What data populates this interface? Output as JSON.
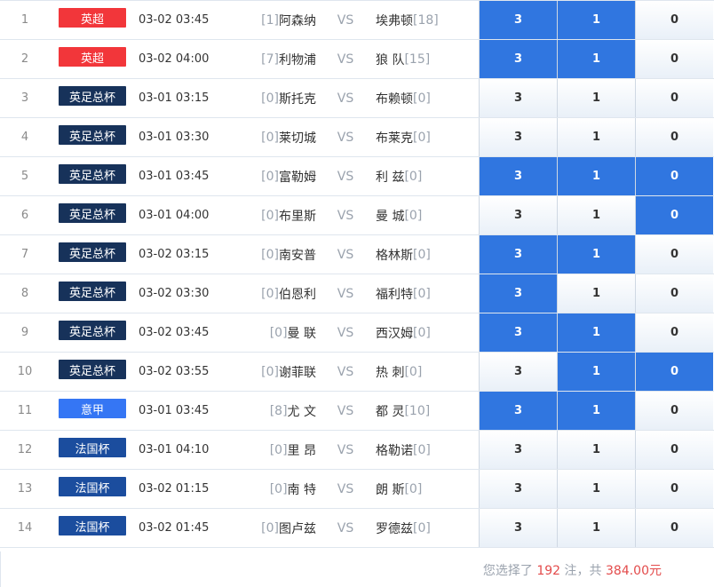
{
  "rows": [
    {
      "idx": "1",
      "league": "英超",
      "league_color": "#f2363a",
      "time": "03-02 03:45",
      "home_rank": "[1]",
      "home": "阿森纳",
      "vs": "VS",
      "away": "埃弗顿",
      "away_rank": "[18]",
      "odds": [
        "3",
        "1",
        "0"
      ],
      "selected": [
        true,
        true,
        false
      ]
    },
    {
      "idx": "2",
      "league": "英超",
      "league_color": "#f2363a",
      "time": "03-02 04:00",
      "home_rank": "[7]",
      "home": "利物浦",
      "vs": "VS",
      "away": "狼 队",
      "away_rank": "[15]",
      "odds": [
        "3",
        "1",
        "0"
      ],
      "selected": [
        true,
        true,
        false
      ]
    },
    {
      "idx": "3",
      "league": "英足总杯",
      "league_color": "#17325a",
      "time": "03-01 03:15",
      "home_rank": "[0]",
      "home": "斯托克",
      "vs": "VS",
      "away": "布赖顿",
      "away_rank": "[0]",
      "odds": [
        "3",
        "1",
        "0"
      ],
      "selected": [
        false,
        false,
        false
      ]
    },
    {
      "idx": "4",
      "league": "英足总杯",
      "league_color": "#17325a",
      "time": "03-01 03:30",
      "home_rank": "[0]",
      "home": "莱切城",
      "vs": "VS",
      "away": "布莱克",
      "away_rank": "[0]",
      "odds": [
        "3",
        "1",
        "0"
      ],
      "selected": [
        false,
        false,
        false
      ]
    },
    {
      "idx": "5",
      "league": "英足总杯",
      "league_color": "#17325a",
      "time": "03-01 03:45",
      "home_rank": "[0]",
      "home": "富勒姆",
      "vs": "VS",
      "away": "利 兹",
      "away_rank": "[0]",
      "odds": [
        "3",
        "1",
        "0"
      ],
      "selected": [
        true,
        true,
        true
      ]
    },
    {
      "idx": "6",
      "league": "英足总杯",
      "league_color": "#17325a",
      "time": "03-01 04:00",
      "home_rank": "[0]",
      "home": "布里斯",
      "vs": "VS",
      "away": "曼 城",
      "away_rank": "[0]",
      "odds": [
        "3",
        "1",
        "0"
      ],
      "selected": [
        false,
        false,
        true
      ]
    },
    {
      "idx": "7",
      "league": "英足总杯",
      "league_color": "#17325a",
      "time": "03-02 03:15",
      "home_rank": "[0]",
      "home": "南安普",
      "vs": "VS",
      "away": "格林斯",
      "away_rank": "[0]",
      "odds": [
        "3",
        "1",
        "0"
      ],
      "selected": [
        true,
        true,
        false
      ]
    },
    {
      "idx": "8",
      "league": "英足总杯",
      "league_color": "#17325a",
      "time": "03-02 03:30",
      "home_rank": "[0]",
      "home": "伯恩利",
      "vs": "VS",
      "away": "福利特",
      "away_rank": "[0]",
      "odds": [
        "3",
        "1",
        "0"
      ],
      "selected": [
        true,
        false,
        false
      ]
    },
    {
      "idx": "9",
      "league": "英足总杯",
      "league_color": "#17325a",
      "time": "03-02 03:45",
      "home_rank": "[0]",
      "home": "曼 联",
      "vs": "VS",
      "away": "西汉姆",
      "away_rank": "[0]",
      "odds": [
        "3",
        "1",
        "0"
      ],
      "selected": [
        true,
        true,
        false
      ]
    },
    {
      "idx": "10",
      "league": "英足总杯",
      "league_color": "#17325a",
      "time": "03-02 03:55",
      "home_rank": "[0]",
      "home": "谢菲联",
      "vs": "VS",
      "away": "热 刺",
      "away_rank": "[0]",
      "odds": [
        "3",
        "1",
        "0"
      ],
      "selected": [
        false,
        true,
        true
      ]
    },
    {
      "idx": "11",
      "league": "意甲",
      "league_color": "#3576f4",
      "time": "03-01 03:45",
      "home_rank": "[8]",
      "home": "尤 文",
      "vs": "VS",
      "away": "都 灵",
      "away_rank": "[10]",
      "odds": [
        "3",
        "1",
        "0"
      ],
      "selected": [
        true,
        true,
        false
      ]
    },
    {
      "idx": "12",
      "league": "法国杯",
      "league_color": "#1b4d9e",
      "time": "03-01 04:10",
      "home_rank": "[0]",
      "home": "里 昂",
      "vs": "VS",
      "away": "格勒诺",
      "away_rank": "[0]",
      "odds": [
        "3",
        "1",
        "0"
      ],
      "selected": [
        false,
        false,
        false
      ]
    },
    {
      "idx": "13",
      "league": "法国杯",
      "league_color": "#1b4d9e",
      "time": "03-02 01:15",
      "home_rank": "[0]",
      "home": "南 特",
      "vs": "VS",
      "away": "朗 斯",
      "away_rank": "[0]",
      "odds": [
        "3",
        "1",
        "0"
      ],
      "selected": [
        false,
        false,
        false
      ]
    },
    {
      "idx": "14",
      "league": "法国杯",
      "league_color": "#1b4d9e",
      "time": "03-02 01:45",
      "home_rank": "[0]",
      "home": "图卢兹",
      "vs": "VS",
      "away": "罗德兹",
      "away_rank": "[0]",
      "odds": [
        "3",
        "1",
        "0"
      ],
      "selected": [
        false,
        false,
        false
      ]
    }
  ],
  "summary": {
    "prefix": "您选择了",
    "bets": "192",
    "mid": "注，共",
    "amount": "384.00元"
  }
}
